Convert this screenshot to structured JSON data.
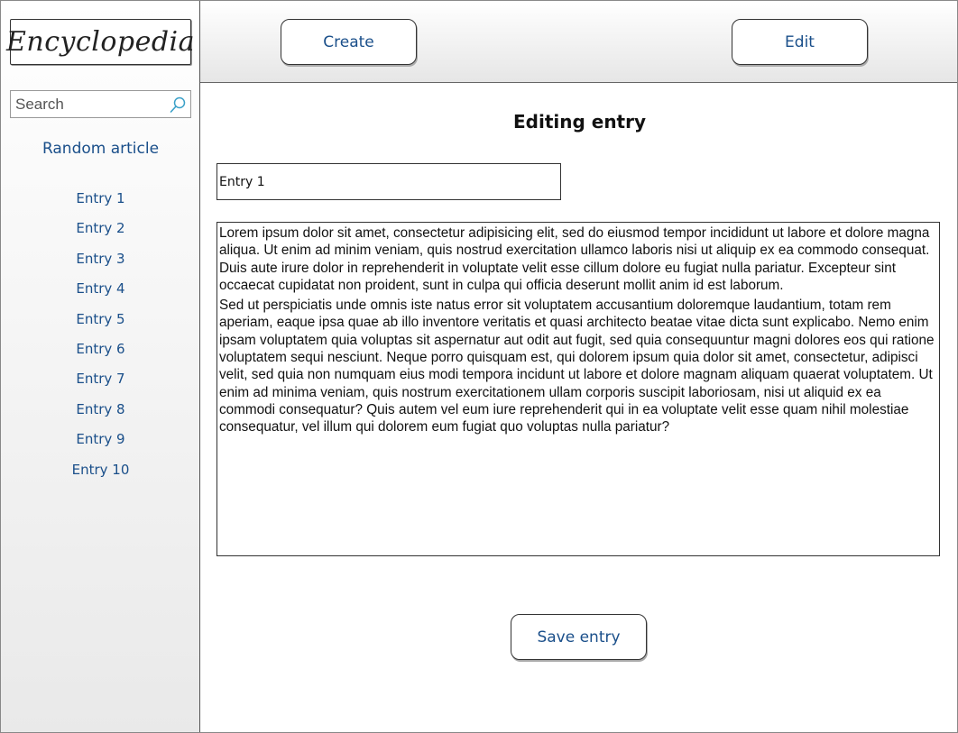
{
  "sidebar": {
    "logo": "Encyclopedia",
    "search_placeholder": "Search",
    "random_article": "Random article",
    "entries": [
      "Entry 1",
      "Entry 2",
      "Entry 3",
      "Entry 4",
      "Entry 5",
      "Entry 6",
      "Entry 7",
      "Entry 8",
      "Entry 9",
      "Entry 10"
    ]
  },
  "toolbar": {
    "create_label": "Create",
    "edit_label": "Edit"
  },
  "main": {
    "title": "Editing entry",
    "entry_title_value": "Entry 1",
    "body_paragraphs": [
      "Lorem ipsum dolor sit amet, consectetur adipisicing elit, sed do eiusmod tempor incididunt ut labore et dolore magna aliqua. Ut enim ad minim veniam, quis nostrud exercitation ullamco laboris nisi ut aliquip ex ea commodo consequat. Duis aute irure dolor in reprehenderit in voluptate velit esse cillum dolore eu fugiat nulla pariatur. Excepteur sint occaecat cupidatat non proident, sunt in culpa qui officia deserunt mollit anim id est laborum.",
      "Sed ut perspiciatis unde omnis iste natus error sit voluptatem accusantium doloremque laudantium, totam rem aperiam, eaque ipsa quae ab illo inventore veritatis et quasi architecto beatae vitae dicta sunt explicabo. Nemo enim ipsam voluptatem quia voluptas sit aspernatur aut odit aut fugit, sed quia consequuntur magni dolores eos qui ratione voluptatem sequi nesciunt. Neque porro quisquam est, qui dolorem ipsum quia dolor sit amet, consectetur, adipisci velit, sed quia non numquam eius modi tempora incidunt ut labore et dolore magnam aliquam quaerat voluptatem. Ut enim ad minima veniam, quis nostrum exercitationem ullam corporis suscipit laboriosam, nisi ut aliquid ex ea commodi consequatur? Quis autem vel eum iure reprehenderit qui in ea voluptate velit esse quam nihil molestiae consequatur, vel illum qui dolorem eum fugiat quo voluptas nulla pariatur?"
    ],
    "save_label": "Save entry"
  },
  "icons": {
    "search": "search-icon"
  },
  "colors": {
    "link": "#1a4f8a",
    "search_icon": "#3aa0c8"
  }
}
